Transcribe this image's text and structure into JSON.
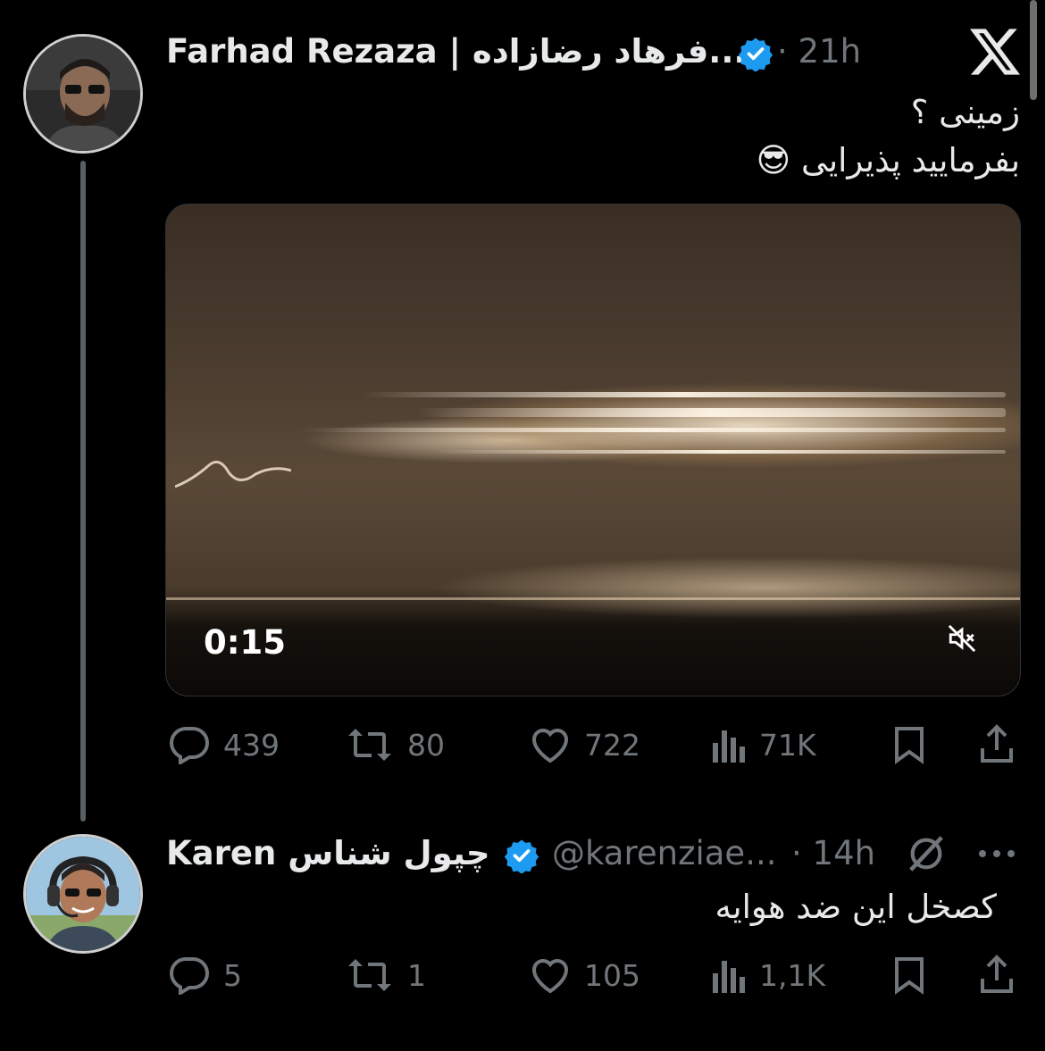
{
  "tweet1": {
    "display_name": "Farhad Rezaza | فرهاد رضازاده...",
    "time": "· 21h",
    "text_line1": "زمینی ؟",
    "text_line2": "بفرمایید پذیرایی 😎",
    "video_duration": "0:15",
    "replies": "439",
    "reposts": "80",
    "likes": "722",
    "views": "71K"
  },
  "tweet2": {
    "display_name": "Karen چپول شناس",
    "handle": "@karenziae...",
    "time": "· 14h",
    "text": "کصخل این ضد هوایه",
    "replies": "5",
    "reposts": "1",
    "likes": "105",
    "views": "1,1K"
  },
  "icons": {
    "x_logo": "x-logo-icon",
    "verified": "verified-badge-icon",
    "grok": "grok-icon",
    "more": "more-icon",
    "reply": "reply-icon",
    "repost": "repost-icon",
    "like": "like-icon",
    "views": "views-icon",
    "bookmark": "bookmark-icon",
    "share": "share-icon",
    "mute": "mute-icon"
  },
  "colors": {
    "background": "#000000",
    "text_primary": "#e7e9ea",
    "text_secondary": "#71767b",
    "verified_blue": "#1d9bf0"
  }
}
